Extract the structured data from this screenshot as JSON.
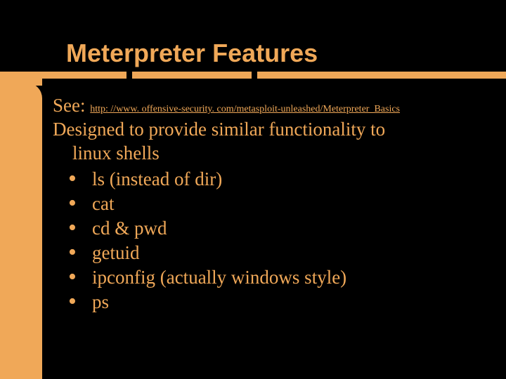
{
  "title": "Meterpreter Features",
  "see_label": "See:",
  "see_url": "http: //www. offensive-security. com/metasploit-unleashed/Meterpreter_Basics",
  "description_line1": "Designed to provide similar functionality to",
  "description_line2": "linux shells",
  "bullets": [
    "ls (instead of dir)",
    "cat",
    "cd & pwd",
    "getuid",
    "ipconfig (actually windows style)",
    "ps"
  ]
}
